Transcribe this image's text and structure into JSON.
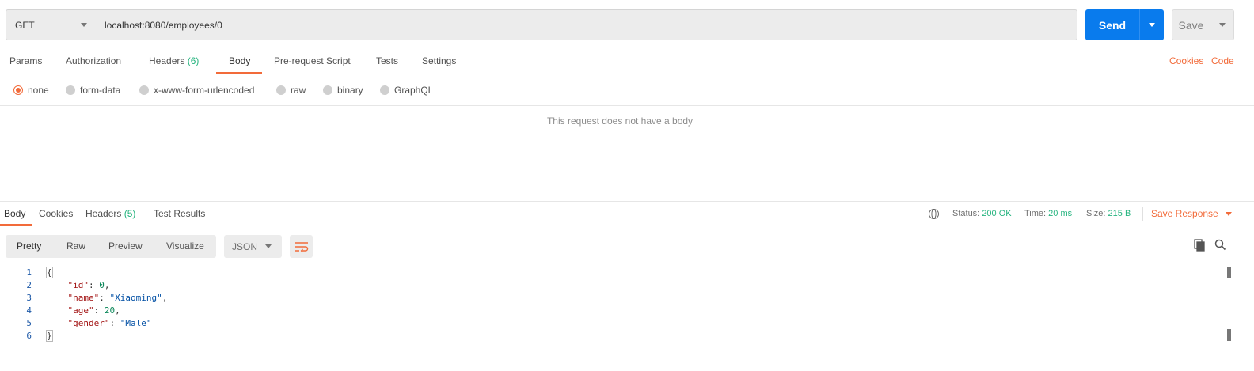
{
  "request": {
    "method": "GET",
    "url": "localhost:8080/employees/0",
    "send_label": "Send",
    "save_label": "Save"
  },
  "request_tabs": [
    {
      "label": "Params"
    },
    {
      "label": "Authorization"
    },
    {
      "label": "Headers",
      "count": "(6)"
    },
    {
      "label": "Body",
      "active": true
    },
    {
      "label": "Pre-request Script"
    },
    {
      "label": "Tests"
    },
    {
      "label": "Settings"
    }
  ],
  "request_links": {
    "cookies": "Cookies",
    "code": "Code"
  },
  "body_types": [
    {
      "label": "none",
      "selected": true
    },
    {
      "label": "form-data"
    },
    {
      "label": "x-www-form-urlencoded"
    },
    {
      "label": "raw"
    },
    {
      "label": "binary"
    },
    {
      "label": "GraphQL"
    }
  ],
  "empty_body_message": "This request does not have a body",
  "response_tabs": [
    {
      "label": "Body",
      "active": true
    },
    {
      "label": "Cookies"
    },
    {
      "label": "Headers",
      "count": "(5)"
    },
    {
      "label": "Test Results"
    }
  ],
  "response_meta": {
    "status_label": "Status:",
    "status_value": "200 OK",
    "time_label": "Time:",
    "time_value": "20 ms",
    "size_label": "Size:",
    "size_value": "215 B",
    "save_response": "Save Response"
  },
  "format_toolbar": {
    "modes": [
      "Pretty",
      "Raw",
      "Preview",
      "Visualize"
    ],
    "active_mode": "Pretty",
    "language": "JSON"
  },
  "response_body": {
    "line_numbers": [
      "1",
      "2",
      "3",
      "4",
      "5",
      "6"
    ],
    "open_brace": "{",
    "close_brace": "}",
    "fields": [
      {
        "key": "\"id\"",
        "value": "0",
        "type": "number",
        "comma": ","
      },
      {
        "key": "\"name\"",
        "value": "\"Xiaoming\"",
        "type": "string",
        "comma": ","
      },
      {
        "key": "\"age\"",
        "value": "20",
        "type": "number",
        "comma": ","
      },
      {
        "key": "\"gender\"",
        "value": "\"Male\"",
        "type": "string",
        "comma": ""
      }
    ]
  },
  "colors": {
    "accent": "#f26b3a",
    "send_blue": "#097bed",
    "success_green": "#26b47f"
  },
  "icons": [
    "caret-down-icon",
    "globe-icon",
    "wrap-lines-icon",
    "copy-icon",
    "search-icon"
  ]
}
